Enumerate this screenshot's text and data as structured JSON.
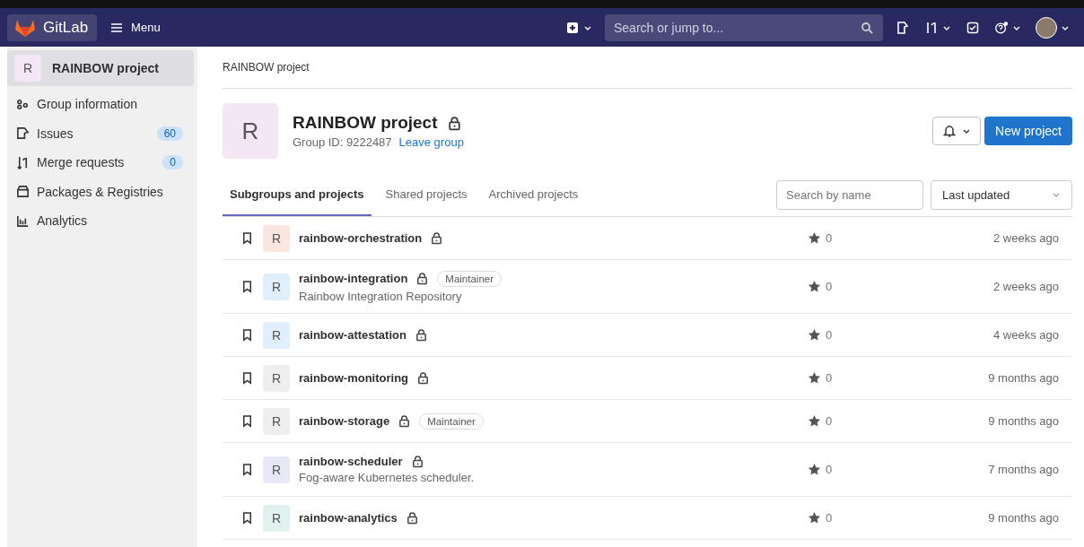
{
  "navbar": {
    "brand": "GitLab",
    "menu_label": "Menu",
    "search": {
      "placeholder": "Search or jump to..."
    },
    "help_notification": true
  },
  "sidebar": {
    "header": {
      "letter": "R",
      "title": "RAINBOW project",
      "selected": true
    },
    "items": [
      {
        "label": "Group information"
      },
      {
        "label": "Issues",
        "count": "60"
      },
      {
        "label": "Merge requests",
        "count": "0"
      },
      {
        "label": "Packages & Registries"
      },
      {
        "label": "Analytics"
      }
    ]
  },
  "breadcrumb": "RAINBOW project",
  "group": {
    "letter": "R",
    "title": "RAINBOW project",
    "private": true,
    "group_id": "Group ID: 9222487",
    "leave_link": "Leave group",
    "new_button": "New project"
  },
  "tabs": [
    {
      "label": "Subgroups and projects",
      "selected": true
    },
    {
      "label": "Shared projects",
      "selected": false
    },
    {
      "label": "Archived projects",
      "selected": false
    }
  ],
  "filter": {
    "placeholder": "Search by name"
  },
  "sort": {
    "value": "Last updated"
  },
  "projects": [
    {
      "letter": "R",
      "color": "#fbe5e1",
      "name": "rainbow-orchestration",
      "private": true,
      "star_count": "0",
      "updated": "2 weeks ago"
    },
    {
      "letter": "R",
      "color": "#e1eefb",
      "name": "rainbow-integration",
      "private": true,
      "role": "Maintainer",
      "description": "Rainbow Integration Repository",
      "star_count": "0",
      "updated": "2 weeks ago"
    },
    {
      "letter": "R",
      "color": "#e1eefb",
      "name": "rainbow-attestation",
      "private": true,
      "star_count": "0",
      "updated": "4 weeks ago"
    },
    {
      "letter": "R",
      "color": "#eeeeee",
      "name": "rainbow-monitoring",
      "private": true,
      "star_count": "0",
      "updated": "9 months ago"
    },
    {
      "letter": "R",
      "color": "#eeeeee",
      "name": "rainbow-storage",
      "private": true,
      "role": "Maintainer",
      "star_count": "0",
      "updated": "9 months ago"
    },
    {
      "letter": "R",
      "color": "#e6e8f5",
      "name": "rainbow-scheduler",
      "private": true,
      "description": "Fog-aware Kubernetes scheduler.",
      "star_count": "0",
      "updated": "7 months ago"
    },
    {
      "letter": "R",
      "color": "#e0f1ef",
      "name": "rainbow-analytics",
      "private": true,
      "star_count": "0",
      "updated": "9 months ago"
    }
  ]
}
